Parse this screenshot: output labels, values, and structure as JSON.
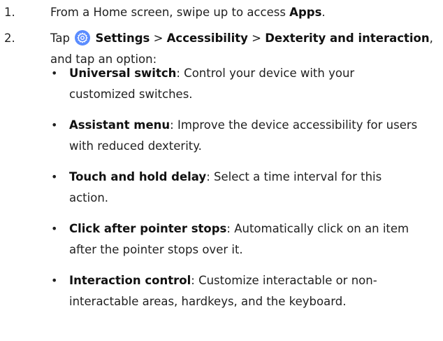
{
  "steps": [
    {
      "number": "1.",
      "text_prefix": "From a Home screen, swipe up to access ",
      "bold": "Apps",
      "text_suffix": "."
    },
    {
      "number": "2.",
      "tap": "Tap",
      "icon": "settings-gear-icon",
      "settings": "Settings",
      "sep1": ">",
      "accessibility": "Accessibility",
      "sep2": ">",
      "dexterity": "Dexterity and interaction",
      "after_comma": ",",
      "line2": "and tap an option:"
    }
  ],
  "options": [
    {
      "title": "Universal switch",
      "line1": ": Control your device with your",
      "line2": "customized switches."
    },
    {
      "title": "Assistant menu",
      "line1": ": Improve the device accessibility for users",
      "line2": "with reduced dexterity."
    },
    {
      "title": "Touch and hold delay",
      "line1": ": Select a time interval for this",
      "line2": "action."
    },
    {
      "title": "Click after pointer stops",
      "line1": ": Automatically click on an item",
      "line2": "after the pointer stops over it."
    },
    {
      "title": "Interaction control",
      "line1": ": Customize interactable or non-",
      "line2": "interactable areas, hardkeys, and the keyboard."
    }
  ],
  "bullet_glyph": "•",
  "colors": {
    "text": "#1f1f1f",
    "icon_outer": "#5a8cff",
    "icon_inner": "#3b6de8"
  }
}
